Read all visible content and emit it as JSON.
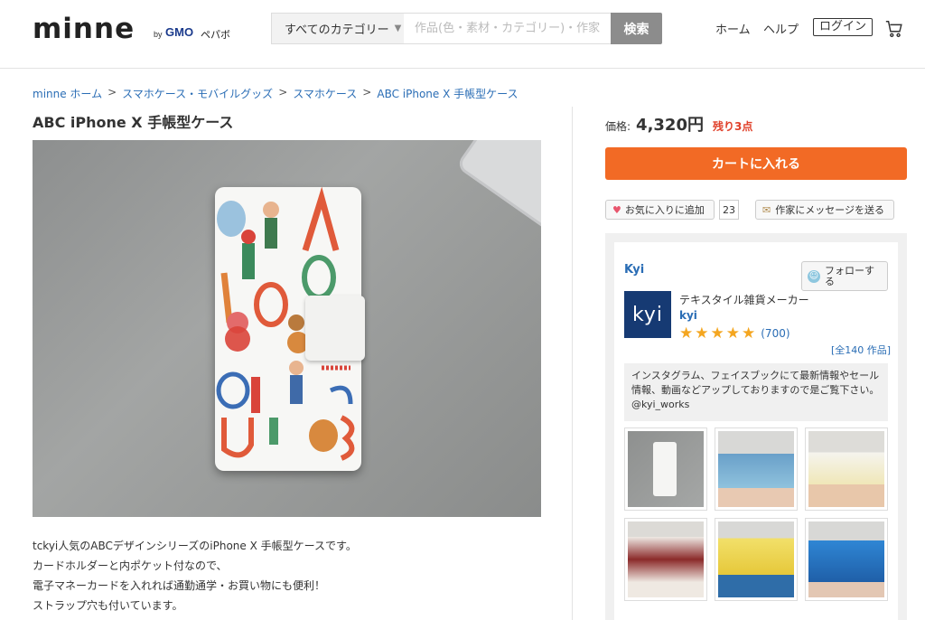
{
  "header": {
    "logo": "minne",
    "logo_by": "by",
    "logo_gmo": "GMO",
    "logo_pepabo": "ペパボ",
    "category_select": "すべてのカテゴリー",
    "search_placeholder": "作品(色・素材・カテゴリー)・作家",
    "search_button": "検索",
    "nav_home": "ホーム",
    "nav_help": "ヘルプ",
    "nav_login": "ログイン",
    "cart_icon": "cart-icon"
  },
  "breadcrumb": [
    "minne ホーム",
    "スマホケース・モバイルグッズ",
    "スマホケース",
    "ABC iPhone X 手帳型ケース"
  ],
  "breadcrumb_separator": ">",
  "product": {
    "title": "ABC iPhone X 手帳型ケース",
    "description": [
      "tckyi人気のABCデザインシリーズのiPhone X 手帳型ケースです。",
      "カードホルダーと内ポケット付なので、",
      "電子マネーカードを入れれば通勤通学・お買い物にも便利！",
      "ストラップ穴も付いています。"
    ]
  },
  "purchase": {
    "price_label": "価格:",
    "price": "4,320円",
    "stock": "残り3点",
    "cart_button": "カートに入れる",
    "favorite_button": "お気に入りに追加",
    "favorite_count": "23",
    "message_button": "作家にメッセージを送る"
  },
  "shop": {
    "name": "Kyi",
    "follow_button": "フォローする",
    "logo_text": "kyi",
    "tagline": "テキスタイル雑貨メーカー",
    "link": "kyi",
    "rating_stars": 5,
    "review_count": "(700)",
    "works_count": "[全140 作品]",
    "description": "インスタグラム、フェイスブックにて最新情報やセール情報、動画などアップしておりますので是ご覧下さい。@kyi_works"
  },
  "colors": {
    "accent_orange": "#f26a25",
    "link_blue": "#2a6db5",
    "stock_red": "#e0402a",
    "star_gold": "#f4a620",
    "shop_logo_bg": "#163a73"
  }
}
